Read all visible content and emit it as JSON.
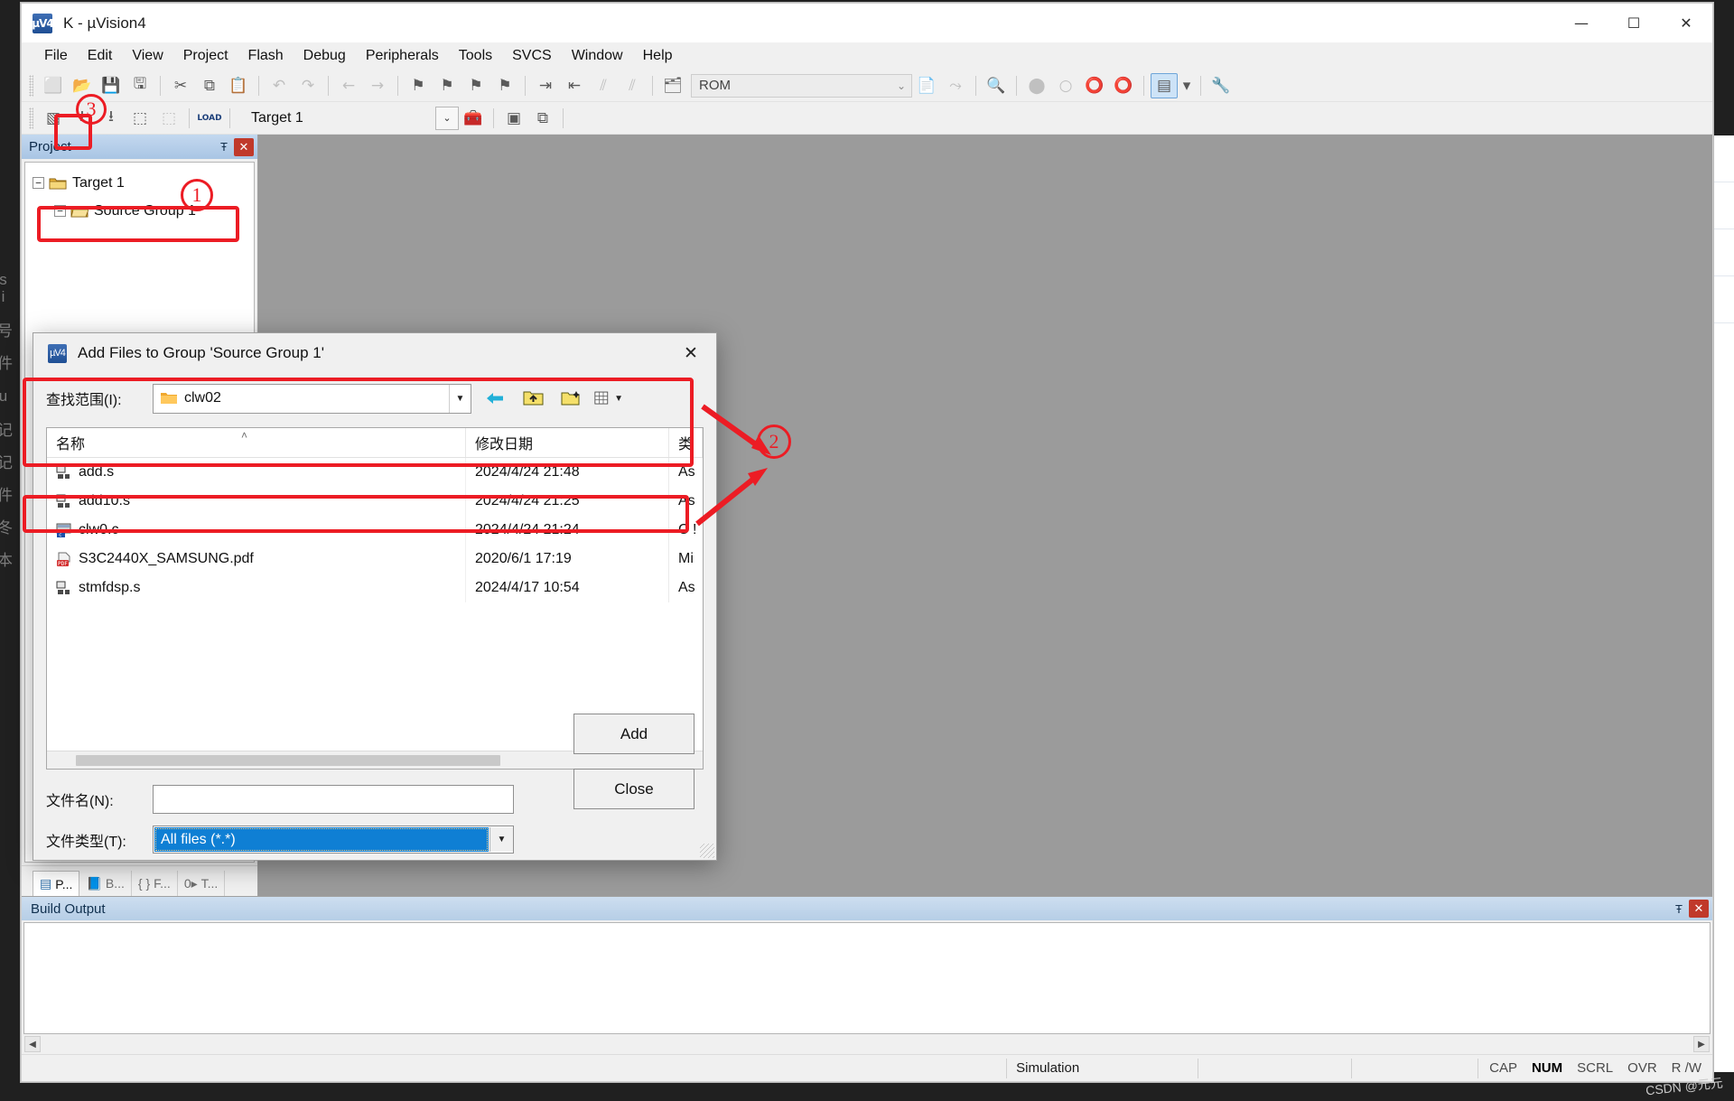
{
  "window": {
    "title": "K  - µVision4",
    "logo_text": "µV4",
    "controls": {
      "minimize": "—",
      "maximize": "☐",
      "close": "✕"
    }
  },
  "menu": {
    "items": [
      {
        "label": "File"
      },
      {
        "label": "Edit"
      },
      {
        "label": "View"
      },
      {
        "label": "Project"
      },
      {
        "label": "Flash"
      },
      {
        "label": "Debug"
      },
      {
        "label": "Peripherals"
      },
      {
        "label": "Tools"
      },
      {
        "label": "SVCS"
      },
      {
        "label": "Window"
      },
      {
        "label": "Help"
      }
    ]
  },
  "toolbar_main": {
    "rom_combo_value": "ROM",
    "buttons": [
      {
        "name": "new-file",
        "glyph": "⬜"
      },
      {
        "name": "open-file",
        "glyph": "📂"
      },
      {
        "name": "save",
        "glyph": "💾"
      },
      {
        "name": "save-all",
        "glyph": "🖫"
      },
      {
        "name": "cut",
        "glyph": "✂"
      },
      {
        "name": "copy",
        "glyph": "⧉"
      },
      {
        "name": "paste",
        "glyph": "📋"
      },
      {
        "name": "undo",
        "glyph": "↶"
      },
      {
        "name": "redo",
        "glyph": "↷"
      },
      {
        "name": "navigate-back",
        "glyph": "←"
      },
      {
        "name": "navigate-forward",
        "glyph": "→"
      },
      {
        "name": "bookmark-toggle",
        "glyph": "⚑"
      },
      {
        "name": "bookmark-prev",
        "glyph": "⚑"
      },
      {
        "name": "bookmark-next",
        "glyph": "⚑"
      },
      {
        "name": "bookmark-clear",
        "glyph": "⚑"
      },
      {
        "name": "indent",
        "glyph": "⇥"
      },
      {
        "name": "outdent",
        "glyph": "⇤"
      },
      {
        "name": "comment-lines",
        "glyph": "⫽"
      },
      {
        "name": "uncomment-lines",
        "glyph": "⫽"
      },
      {
        "name": "configure-target",
        "glyph": "🗂"
      },
      {
        "name": "find-in-files",
        "glyph": "📄"
      },
      {
        "name": "run-to-cursor",
        "glyph": "⤳"
      },
      {
        "name": "find",
        "glyph": "🔍"
      },
      {
        "name": "breakpoint-insert",
        "glyph": "⬤"
      },
      {
        "name": "breakpoint-disable",
        "glyph": "○"
      },
      {
        "name": "breakpoint-disable-all",
        "glyph": "⭕"
      },
      {
        "name": "breakpoint-kill-all",
        "glyph": "⭕"
      },
      {
        "name": "project-window-toggle",
        "glyph": "▤"
      },
      {
        "name": "configuration-wizard",
        "glyph": "🔧"
      }
    ]
  },
  "toolbar_build": {
    "target_value": "Target 1",
    "buttons": [
      {
        "name": "translate",
        "glyph": "▧"
      },
      {
        "name": "build-target",
        "glyph": "⭳"
      },
      {
        "name": "rebuild-all",
        "glyph": "⭳"
      },
      {
        "name": "batch-build",
        "glyph": "⬚"
      },
      {
        "name": "stop-build",
        "glyph": "⬚"
      },
      {
        "name": "download",
        "glyph": "LOAD"
      },
      {
        "name": "target-options",
        "glyph": "🧰"
      },
      {
        "name": "manage-components",
        "glyph": "▣"
      },
      {
        "name": "manage-multi-project",
        "glyph": "⧉"
      }
    ]
  },
  "project_panel": {
    "header_title": "Project",
    "pin_glyph": "Ŧ",
    "close_glyph": "✕",
    "tree": [
      {
        "label": "Target 1",
        "expander": "−",
        "depth": 0
      },
      {
        "label": "Source Group 1",
        "expander": "−",
        "depth": 1
      }
    ],
    "tabs": [
      {
        "label": "P...",
        "name": "tab-project",
        "active": true
      },
      {
        "label": "B...",
        "name": "tab-books",
        "active": false
      },
      {
        "label": "F...",
        "name": "tab-functions",
        "active": false
      },
      {
        "label": "T...",
        "name": "tab-templates",
        "active": false
      }
    ],
    "tab_icons": [
      "▤",
      "📘",
      "{ }",
      "0▸"
    ]
  },
  "build_output": {
    "header_title": "Build Output",
    "pin_glyph": "Ŧ",
    "close_glyph": "✕",
    "content": "",
    "scroll_left_glyph": "◀",
    "scroll_right_glyph": "▶"
  },
  "status_bar": {
    "left_text": "",
    "simulation_text": "Simulation",
    "indicators": [
      {
        "label": "CAP",
        "on": false
      },
      {
        "label": "NUM",
        "on": true
      },
      {
        "label": "SCRL",
        "on": false
      },
      {
        "label": "OVR",
        "on": false
      },
      {
        "label": "R /W",
        "on": false
      }
    ]
  },
  "dialog": {
    "title": "Add Files to Group 'Source Group 1'",
    "logo_text": "µV4",
    "close_glyph": "✕",
    "lookin_label": "查找范围(I):",
    "lookin_value": "clw02",
    "lookin_caret": "▼",
    "nav_buttons": [
      {
        "name": "back-icon",
        "glyph": "⬅"
      },
      {
        "name": "up-one-level-icon",
        "glyph": "📁"
      },
      {
        "name": "new-folder-icon",
        "glyph": "📁"
      },
      {
        "name": "view-mode-icon",
        "glyph": "▦"
      }
    ],
    "columns": [
      {
        "label": "名称",
        "name": "column-name"
      },
      {
        "label": "修改日期",
        "name": "column-date-modified"
      },
      {
        "label": "类",
        "name": "column-type"
      }
    ],
    "sort_caret": "˄",
    "files": [
      {
        "name": "add.s",
        "date": "2024/4/24 21:48",
        "type": "As",
        "icon": "asm-file-icon"
      },
      {
        "name": "add10.s",
        "date": "2024/4/24 21:25",
        "type": "As",
        "icon": "asm-file-icon"
      },
      {
        "name": "clw0.c",
        "date": "2024/4/24 21:24",
        "type": "C !",
        "icon": "c-file-icon"
      },
      {
        "name": "S3C2440X_SAMSUNG.pdf",
        "date": "2020/6/1 17:19",
        "type": "Mi",
        "icon": "pdf-file-icon"
      },
      {
        "name": "stmfdsp.s",
        "date": "2024/4/17 10:54",
        "type": "As",
        "icon": "asm-file-icon"
      }
    ],
    "filename_label": "文件名(N):",
    "filename_value": "",
    "filename_placeholder": "",
    "filetype_label": "文件类型(T):",
    "filetype_value": "All files (*.*)",
    "filetype_caret": "▼",
    "add_button": "Add",
    "close_button": "Close"
  },
  "annotations": {
    "marker_1": "1",
    "marker_2": "2",
    "marker_3": "3",
    "accent_color": "#ec1c24"
  },
  "watermark": "CSDN @元元",
  "background_text": "si 号 件 u 记 记 件 冬 本"
}
